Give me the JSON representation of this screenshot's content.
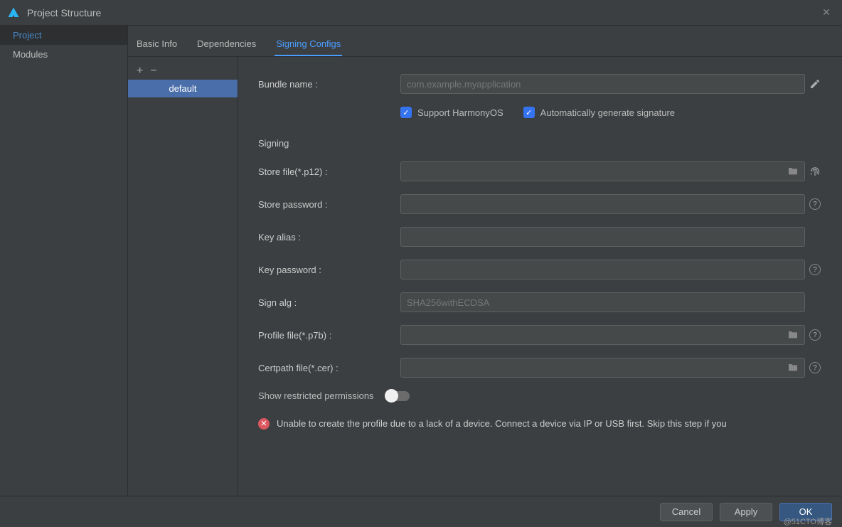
{
  "window": {
    "title": "Project Structure"
  },
  "sidebar": {
    "items": [
      {
        "label": "Project",
        "selected": true
      },
      {
        "label": "Modules",
        "selected": false
      }
    ]
  },
  "tabs": [
    {
      "label": "Basic Info",
      "selected": false
    },
    {
      "label": "Dependencies",
      "selected": false
    },
    {
      "label": "Signing Configs",
      "selected": true
    }
  ],
  "configs": {
    "add": "+",
    "remove": "−",
    "items": [
      {
        "label": "default",
        "selected": true
      }
    ]
  },
  "form": {
    "bundle_name_label": "Bundle name :",
    "bundle_name_placeholder": "com.example.myapplication",
    "support_harmony_label": "Support HarmonyOS",
    "auto_sign_label": "Automatically generate signature",
    "signing_section": "Signing",
    "store_file_label": "Store file(*.p12) :",
    "store_password_label": "Store password :",
    "key_alias_label": "Key alias :",
    "key_password_label": "Key password :",
    "sign_alg_label": "Sign alg :",
    "sign_alg_value": "SHA256withECDSA",
    "profile_file_label": "Profile file(*.p7b) :",
    "certpath_file_label": "Certpath file(*.cer) :",
    "restricted_label": "Show restricted permissions",
    "error_text": "Unable to create the profile due to a lack of a device. Connect a device via IP or USB first. Skip this step if you"
  },
  "footer": {
    "cancel": "Cancel",
    "apply": "Apply",
    "ok": "OK"
  },
  "watermark": "@51CTO博客"
}
